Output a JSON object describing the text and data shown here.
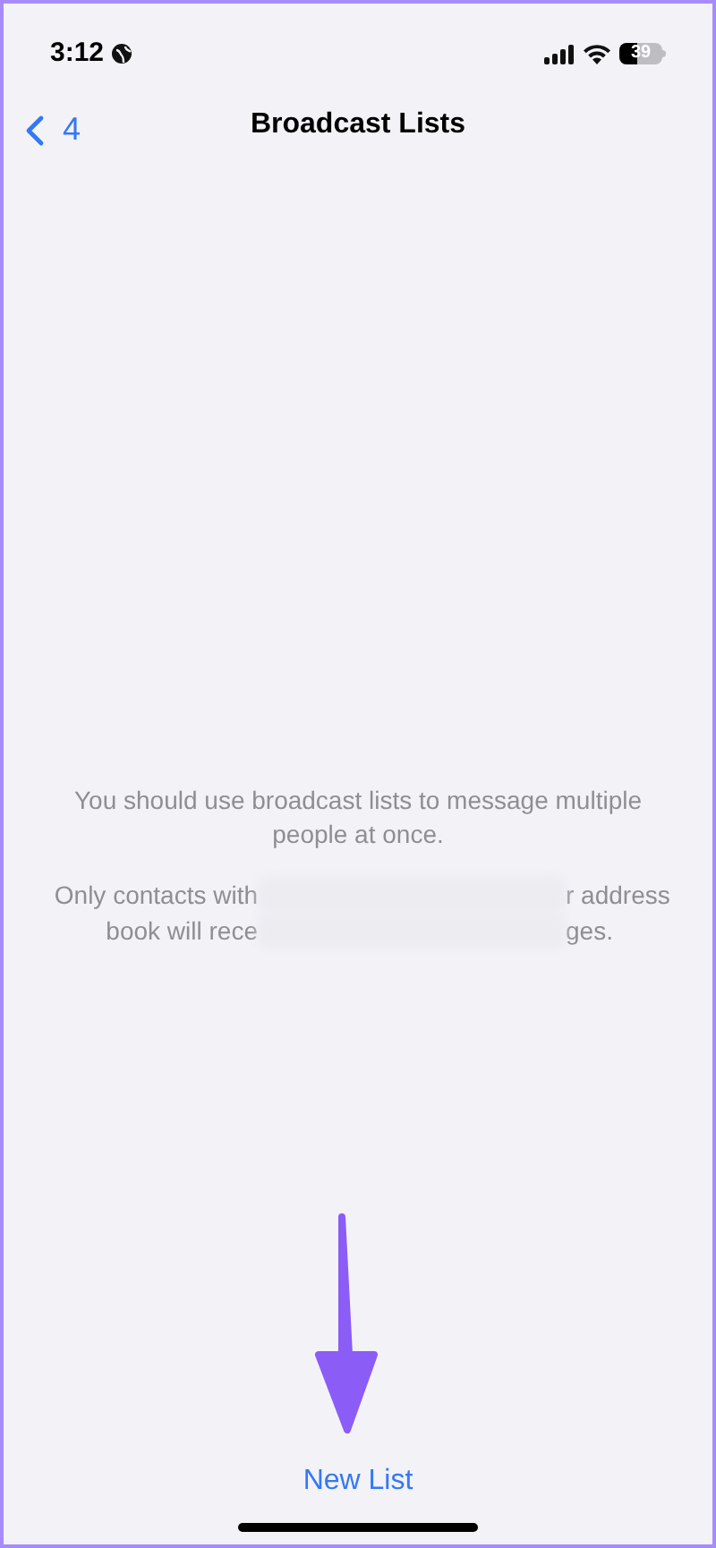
{
  "status_bar": {
    "time": "3:12",
    "battery": "39"
  },
  "nav": {
    "back_label": "4",
    "title": "Broadcast Lists"
  },
  "info": {
    "text": "You should use broadcast lists to message multiple people at once.",
    "note_lines": [
      {
        "left": "Only contacts with",
        "right": "r address"
      },
      {
        "left": "book will rece",
        "right": "ges."
      }
    ]
  },
  "action": {
    "label": "New List"
  }
}
